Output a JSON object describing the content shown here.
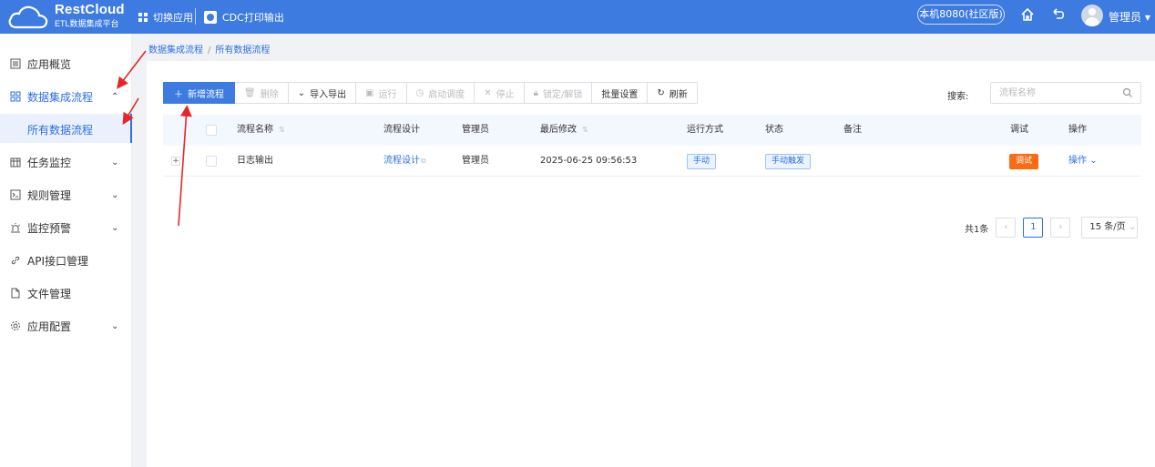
{
  "topbar": {
    "brand_title": "RestCloud",
    "brand_subtitle": "ETL数据集成平台",
    "switch_app": "切换应用",
    "current_app": "CDC打印输出",
    "environment": "本机8080(社区版)",
    "user": "管理员"
  },
  "sidebar": {
    "items": [
      {
        "label": "应用概览",
        "icon": "document-icon"
      },
      {
        "label": "数据集成流程",
        "icon": "grid-icon",
        "expanded": true
      },
      {
        "label": "任务监控",
        "icon": "calendar-icon"
      },
      {
        "label": "规则管理",
        "icon": "terminal-icon"
      },
      {
        "label": "监控预警",
        "icon": "alarm-icon"
      },
      {
        "label": "API接口管理",
        "icon": "link-icon"
      },
      {
        "label": "文件管理",
        "icon": "file-icon"
      },
      {
        "label": "应用配置",
        "icon": "settings-icon"
      }
    ],
    "active_sub": "所有数据流程"
  },
  "breadcrumb": {
    "parent": "数据集成流程",
    "separator": "/",
    "current": "所有数据流程"
  },
  "toolbar": {
    "new_flow": "新增流程",
    "delete": "删除",
    "import_export": "导入导出",
    "run": "运行",
    "start_schedule": "启动调度",
    "stop": "停止",
    "lock_unlock": "锁定/解锁",
    "batch_settings": "批量设置",
    "refresh": "刷新"
  },
  "search": {
    "label": "搜索:",
    "placeholder": "流程名称"
  },
  "table": {
    "headers": {
      "name": "流程名称",
      "design": "流程设计",
      "admin": "管理员",
      "modified": "最后修改",
      "run_mode": "运行方式",
      "status": "状态",
      "remark": "备注",
      "debug": "调试",
      "actions": "操作"
    },
    "rows": [
      {
        "name": "日志输出",
        "design": "流程设计",
        "admin": "管理员",
        "modified": "2025-06-25 09:56:53",
        "run_mode": "手动",
        "status": "手动触发",
        "remark": "",
        "debug": "调试",
        "actions": "操作"
      }
    ]
  },
  "pagination": {
    "total": "共1条",
    "current_page": "1",
    "page_size": "15 条/页"
  },
  "colors": {
    "accent": "#3d7be0",
    "link": "#2f6fe0",
    "debug_tag": "#fa6b12",
    "annotation_arrow": "#e8262a"
  }
}
